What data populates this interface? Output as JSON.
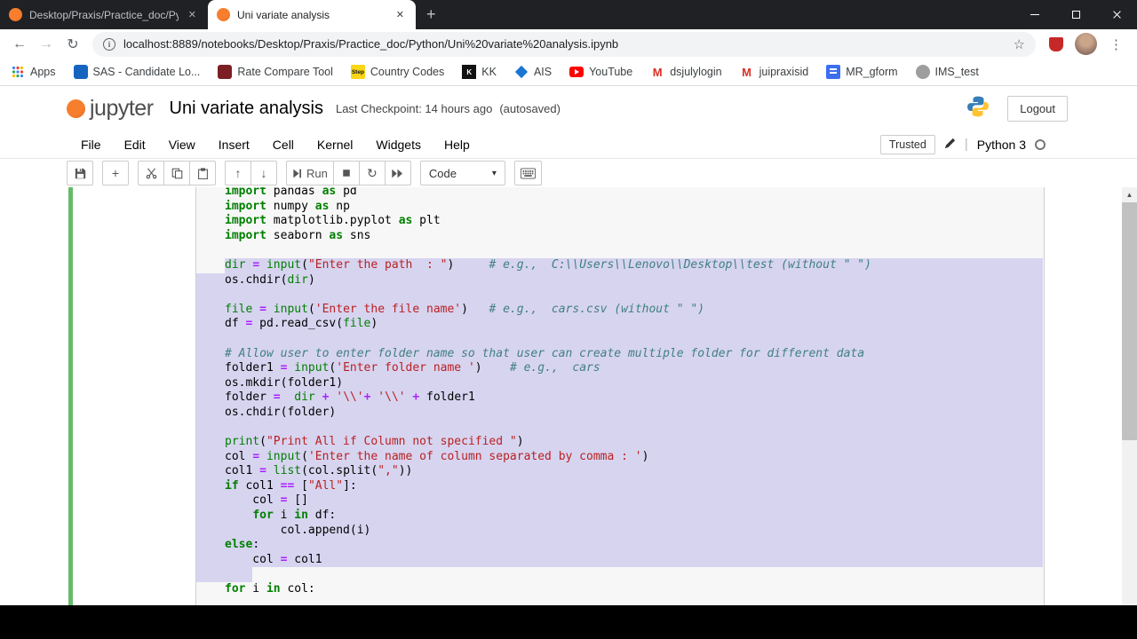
{
  "browser": {
    "tabs": [
      {
        "title": "Desktop/Praxis/Practice_doc/Pyt",
        "active": false
      },
      {
        "title": "Uni variate analysis",
        "active": true
      }
    ],
    "url": "localhost:8889/notebooks/Desktop/Praxis/Practice_doc/Python/Uni%20variate%20analysis.ipynb",
    "bookmarks": [
      {
        "label": "Apps",
        "badge": ""
      },
      {
        "label": "SAS - Candidate Lo...",
        "badge": ""
      },
      {
        "label": "Rate Compare Tool",
        "badge": ""
      },
      {
        "label": "Country Codes",
        "badge": "Step"
      },
      {
        "label": "KK",
        "badge": "K"
      },
      {
        "label": "AIS",
        "badge": ""
      },
      {
        "label": "YouTube",
        "badge": ""
      },
      {
        "label": "dsjulylogin",
        "badge": "M"
      },
      {
        "label": "juipraxisid",
        "badge": "M"
      },
      {
        "label": "MR_gform",
        "badge": ""
      },
      {
        "label": "IMS_test",
        "badge": ""
      }
    ]
  },
  "icons": {
    "back": "←",
    "forward": "→",
    "refresh": "↻",
    "star": "☆",
    "menu_dots": "⋮",
    "new_tab": "+",
    "close": "✕",
    "caret": "▾",
    "arrow_up": "↑",
    "arrow_down": "↓",
    "info": "i",
    "scroll_up": "▲"
  },
  "notebook": {
    "logo_text": "jupyter",
    "title": "Uni variate analysis",
    "checkpoint": "Last Checkpoint: 14 hours ago",
    "autosaved": "(autosaved)",
    "logout_label": "Logout",
    "menu": [
      "File",
      "Edit",
      "View",
      "Insert",
      "Cell",
      "Kernel",
      "Widgets",
      "Help"
    ],
    "trusted_label": "Trusted",
    "kernel_name": "Python 3",
    "run_label": "Run",
    "cell_type": "Code",
    "colors": {
      "selection": "#d7d4f0",
      "edit_mode_border": "#66bb6a",
      "keyword": "#008000",
      "string": "#ba2121",
      "comment": "#408080",
      "operator": "#aa22ff"
    }
  },
  "code": {
    "lines": [
      {
        "sel": "none",
        "tokens": [
          [
            "k",
            "import"
          ],
          [
            "t",
            " pandas "
          ],
          [
            "k",
            "as"
          ],
          [
            "t",
            " pd"
          ]
        ]
      },
      {
        "sel": "none",
        "tokens": [
          [
            "k",
            "import"
          ],
          [
            "t",
            " numpy "
          ],
          [
            "k",
            "as"
          ],
          [
            "t",
            " np"
          ]
        ]
      },
      {
        "sel": "none",
        "tokens": [
          [
            "k",
            "import"
          ],
          [
            "t",
            " matplotlib.pyplot "
          ],
          [
            "k",
            "as"
          ],
          [
            "t",
            " plt"
          ]
        ]
      },
      {
        "sel": "none",
        "tokens": [
          [
            "k",
            "import"
          ],
          [
            "t",
            " seaborn "
          ],
          [
            "k",
            "as"
          ],
          [
            "t",
            " sns"
          ]
        ]
      },
      {
        "sel": "none",
        "tokens": []
      },
      {
        "sel": "start",
        "tokens": [
          [
            "b",
            "dir"
          ],
          [
            "t",
            " "
          ],
          [
            "o",
            "="
          ],
          [
            "t",
            " "
          ],
          [
            "b",
            "input"
          ],
          [
            "t",
            "("
          ],
          [
            "s",
            "\"Enter the path  : \""
          ],
          [
            "t",
            ")     "
          ],
          [
            "c",
            "# e.g.,  C:\\\\Users\\\\Lenovo\\\\Desktop\\\\test (without \" \")"
          ]
        ]
      },
      {
        "sel": "full",
        "tokens": [
          [
            "t",
            "os.chdir("
          ],
          [
            "b",
            "dir"
          ],
          [
            "t",
            ")"
          ]
        ]
      },
      {
        "sel": "full",
        "tokens": []
      },
      {
        "sel": "full",
        "tokens": [
          [
            "b",
            "file"
          ],
          [
            "t",
            " "
          ],
          [
            "o",
            "="
          ],
          [
            "t",
            " "
          ],
          [
            "b",
            "input"
          ],
          [
            "t",
            "("
          ],
          [
            "s",
            "'Enter the file name'"
          ],
          [
            "t",
            ")   "
          ],
          [
            "c",
            "# e.g.,  cars.csv (without \" \")"
          ]
        ]
      },
      {
        "sel": "full",
        "tokens": [
          [
            "t",
            "df "
          ],
          [
            "o",
            "="
          ],
          [
            "t",
            " pd.read_csv("
          ],
          [
            "b",
            "file"
          ],
          [
            "t",
            ")"
          ]
        ]
      },
      {
        "sel": "full",
        "tokens": []
      },
      {
        "sel": "full",
        "tokens": [
          [
            "c",
            "# Allow user to enter folder name so that user can create multiple folder for different data"
          ]
        ]
      },
      {
        "sel": "full",
        "tokens": [
          [
            "t",
            "folder1 "
          ],
          [
            "o",
            "="
          ],
          [
            "t",
            " "
          ],
          [
            "b",
            "input"
          ],
          [
            "t",
            "("
          ],
          [
            "s",
            "'Enter folder name '"
          ],
          [
            "t",
            ")    "
          ],
          [
            "c",
            "# e.g.,  cars"
          ]
        ]
      },
      {
        "sel": "full",
        "tokens": [
          [
            "t",
            "os.mkdir(folder1)"
          ]
        ]
      },
      {
        "sel": "full",
        "tokens": [
          [
            "t",
            "folder "
          ],
          [
            "o",
            "="
          ],
          [
            "t",
            "  "
          ],
          [
            "b",
            "dir"
          ],
          [
            "t",
            " "
          ],
          [
            "o",
            "+"
          ],
          [
            "t",
            " "
          ],
          [
            "s",
            "'\\\\'"
          ],
          [
            "o",
            "+"
          ],
          [
            "t",
            " "
          ],
          [
            "s",
            "'\\\\'"
          ],
          [
            "t",
            " "
          ],
          [
            "o",
            "+"
          ],
          [
            "t",
            " folder1"
          ]
        ]
      },
      {
        "sel": "full",
        "tokens": [
          [
            "t",
            "os.chdir(folder)"
          ]
        ]
      },
      {
        "sel": "full",
        "tokens": []
      },
      {
        "sel": "full",
        "tokens": [
          [
            "b",
            "print"
          ],
          [
            "t",
            "("
          ],
          [
            "s",
            "\"Print All if Column not specified \""
          ],
          [
            "t",
            ")"
          ]
        ]
      },
      {
        "sel": "full",
        "tokens": [
          [
            "t",
            "col "
          ],
          [
            "o",
            "="
          ],
          [
            "t",
            " "
          ],
          [
            "b",
            "input"
          ],
          [
            "t",
            "("
          ],
          [
            "s",
            "'Enter the name of column separated by comma : '"
          ],
          [
            "t",
            ")"
          ]
        ]
      },
      {
        "sel": "full",
        "tokens": [
          [
            "t",
            "col1 "
          ],
          [
            "o",
            "="
          ],
          [
            "t",
            " "
          ],
          [
            "b",
            "list"
          ],
          [
            "t",
            "(col.split("
          ],
          [
            "s",
            "\",\""
          ],
          [
            "t",
            "))"
          ]
        ]
      },
      {
        "sel": "full",
        "tokens": [
          [
            "k",
            "if"
          ],
          [
            "t",
            " col1 "
          ],
          [
            "o",
            "=="
          ],
          [
            "t",
            " ["
          ],
          [
            "s",
            "\"All\""
          ],
          [
            "t",
            "]:"
          ]
        ]
      },
      {
        "sel": "full",
        "tokens": [
          [
            "t",
            "    col "
          ],
          [
            "o",
            "="
          ],
          [
            "t",
            " []"
          ]
        ]
      },
      {
        "sel": "full",
        "tokens": [
          [
            "t",
            "    "
          ],
          [
            "k",
            "for"
          ],
          [
            "t",
            " i "
          ],
          [
            "k",
            "in"
          ],
          [
            "t",
            " df:"
          ]
        ]
      },
      {
        "sel": "full",
        "tokens": [
          [
            "t",
            "        col.append(i)"
          ]
        ]
      },
      {
        "sel": "full",
        "tokens": [
          [
            "k",
            "else"
          ],
          [
            "t",
            ":"
          ]
        ]
      },
      {
        "sel": "full",
        "tokens": [
          [
            "t",
            "    col "
          ],
          [
            "o",
            "="
          ],
          [
            "t",
            " col1"
          ]
        ]
      },
      {
        "sel": "end",
        "tokens": []
      },
      {
        "sel": "none",
        "tokens": [
          [
            "k",
            "for"
          ],
          [
            "t",
            " i "
          ],
          [
            "k",
            "in"
          ],
          [
            "t",
            " col:"
          ]
        ]
      }
    ]
  }
}
